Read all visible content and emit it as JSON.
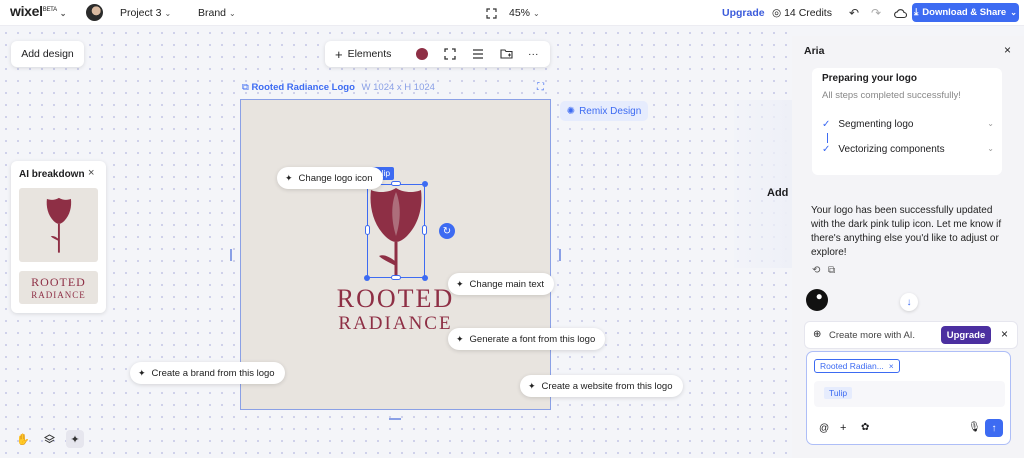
{
  "topbar": {
    "logo": "wixel",
    "logo_badge": "BETA",
    "project": "Project 3",
    "brand_menu": "Brand",
    "zoom": "45%",
    "upgrade": "Upgrade",
    "credits": "14 Credits",
    "download": "Download & Share"
  },
  "canvas": {
    "add_design": "Add design",
    "toolbar": {
      "elements": "Elements",
      "swatch_color": "#8e2f45"
    },
    "frame_title": "Rooted Radiance Logo",
    "frame_size": "W 1024 x H 1024",
    "remix": "Remix Design",
    "logo_text_line1": "ROOTED",
    "logo_text_line2": "RADIANCE",
    "selection_tag": "Tulip",
    "brand_color": "#8e2f45",
    "suggestions": {
      "change_icon": "Change logo icon",
      "change_text": "Change main text",
      "generate_font": "Generate a font from this logo",
      "create_brand": "Create a brand from this logo",
      "create_website": "Create a website from this logo"
    },
    "partial_label": "Add"
  },
  "breakdown": {
    "title": "AI breakdown",
    "text_line1": "ROOTED",
    "text_line2": "RADIANCE"
  },
  "panel": {
    "title": "Aria",
    "steps_title": "Preparing your logo",
    "steps_status": "All steps completed successfully!",
    "steps": [
      "Segmenting logo",
      "Vectorizing components"
    ],
    "message": "Your logo has been successfully updated with the dark pink tulip icon. Let me know if there's anything else you'd like to adjust or explore!",
    "upsell_text": "Create more with AI.",
    "upsell_button": "Upgrade",
    "context_chip": "Rooted Radian...",
    "tag_chip": "Tulip"
  },
  "colors": {
    "accent": "#3d6bf2",
    "brand": "#8e2f45",
    "upgrade_button": "#4b2fa0"
  }
}
